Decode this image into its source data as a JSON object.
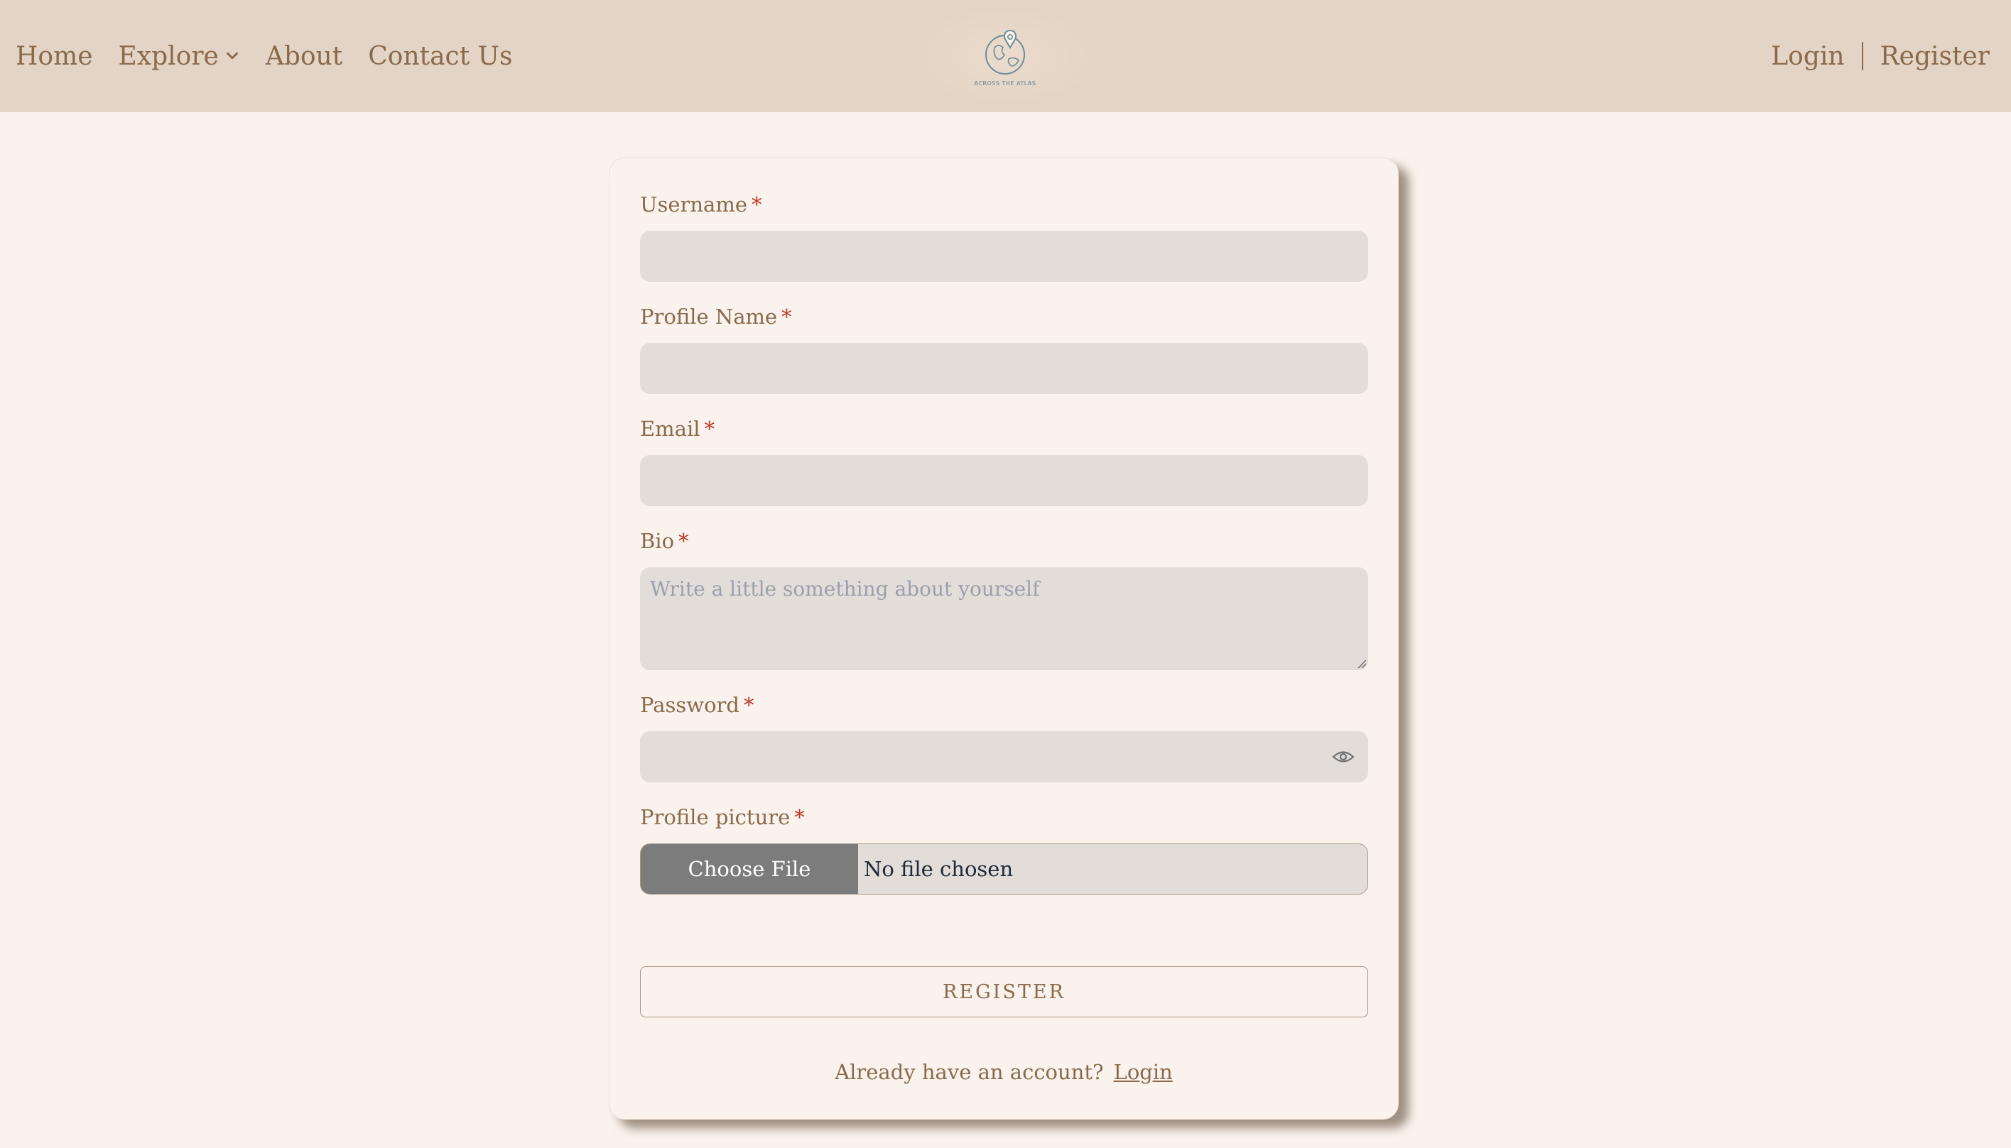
{
  "nav": {
    "home": "Home",
    "explore": "Explore",
    "about": "About",
    "contact": "Contact Us",
    "login": "Login",
    "register": "Register"
  },
  "logo": {
    "text": "ACROSS THE ATLAS",
    "icon": "globe-pin-logo"
  },
  "form": {
    "required_marker": "*",
    "username_label": "Username",
    "username_value": "",
    "profile_name_label": "Profile Name",
    "profile_name_value": "",
    "email_label": "Email",
    "email_value": "",
    "bio_label": "Bio",
    "bio_placeholder": "Write a little something about yourself",
    "password_label": "Password",
    "password_value": "",
    "profile_picture_label": "Profile picture",
    "choose_file_label": "Choose File",
    "file_status": "No file chosen",
    "register_button": "REGISTER",
    "have_account_text": "Already have an account?",
    "login_link": "Login"
  },
  "colors": {
    "page_bg": "#faf2ec",
    "navbar_bg": "#e3d4c6",
    "text_brown": "#8a6a4c",
    "input_bg": "#e2ddd9",
    "required_red": "#c0392b",
    "file_button_bg": "#7c7c7c"
  }
}
